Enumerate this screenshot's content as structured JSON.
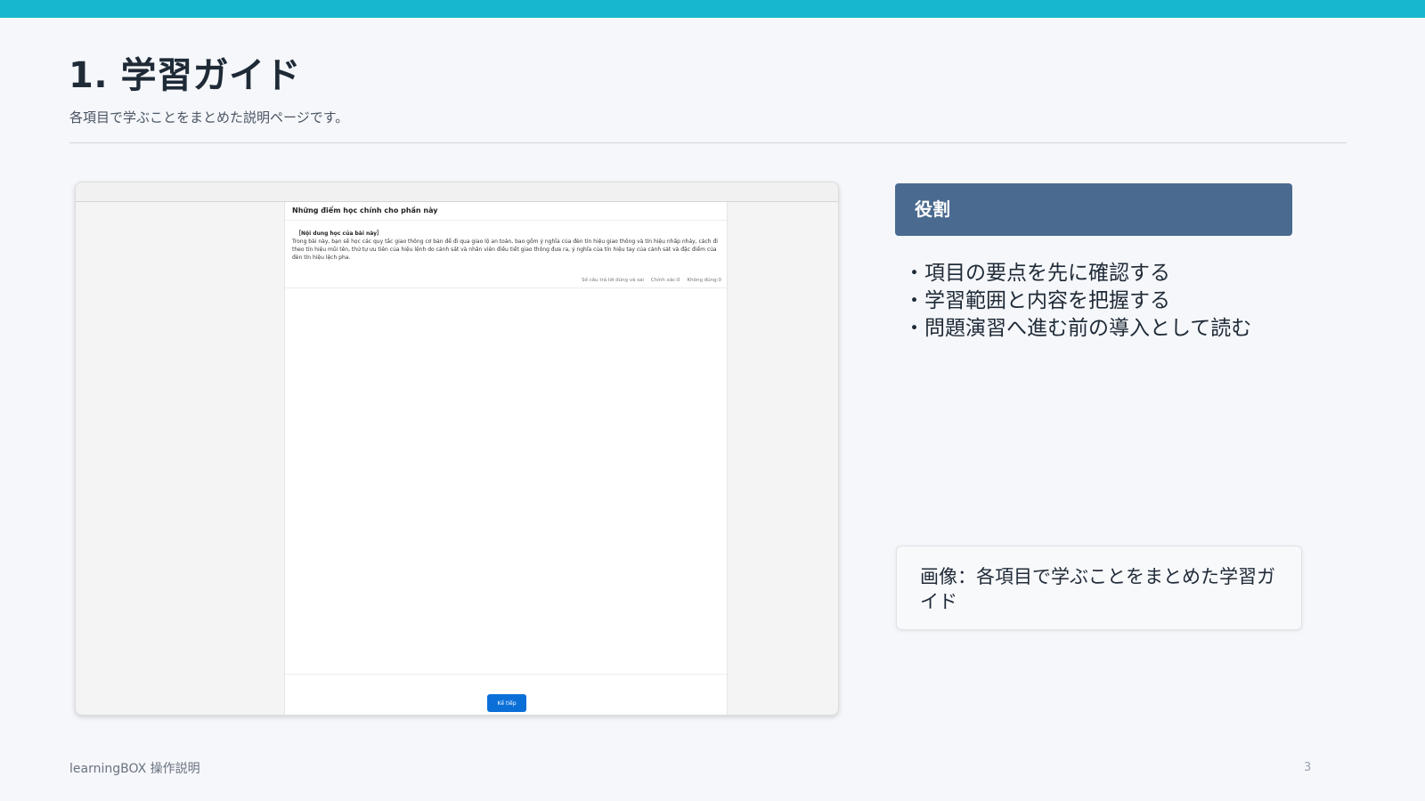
{
  "header": {
    "title": "1. 学習ガイド",
    "subtitle": "各項目で学ぶことをまとめた説明ページです。"
  },
  "screenshot": {
    "heading": "Những điểm học chính cho phần này",
    "content_title": "［Nội dung học của bài này］",
    "content_body": "Trong bài này, bạn sẽ học các quy tắc giao thông cơ bản để đi qua giao lộ an toàn, bao gồm ý nghĩa của đèn tín hiệu giao thông và tín hiệu nhấp nháy, cách đi theo tín hiệu mũi tên, thứ tự ưu tiên của hiệu lệnh do cảnh sát và nhân viên điều tiết giao thông đưa ra, ý nghĩa của tín hiệu tay của cảnh sát và đặc điểm của đèn tín hiệu lệch pha.",
    "counters": {
      "quiz_type": "Số câu trả lời đúng và sai",
      "correct": "Chính xác:0",
      "incorrect": "Không đúng:0"
    },
    "next_button": "Kế tiếp"
  },
  "role": {
    "header": "役割",
    "items": [
      "・項目の要点を先に確認する",
      "・学習範囲と内容を把握する",
      "・問題演習へ進む前の導入として読む"
    ]
  },
  "caption": "画像：各項目で学ぶことをまとめた学習ガイド",
  "footer": {
    "left": "learningBOX 操作説明",
    "page_number": "3"
  },
  "colors": {
    "accent": "#17b8cf",
    "role_header": "#4a6a8f",
    "button": "#0b6fd8"
  }
}
